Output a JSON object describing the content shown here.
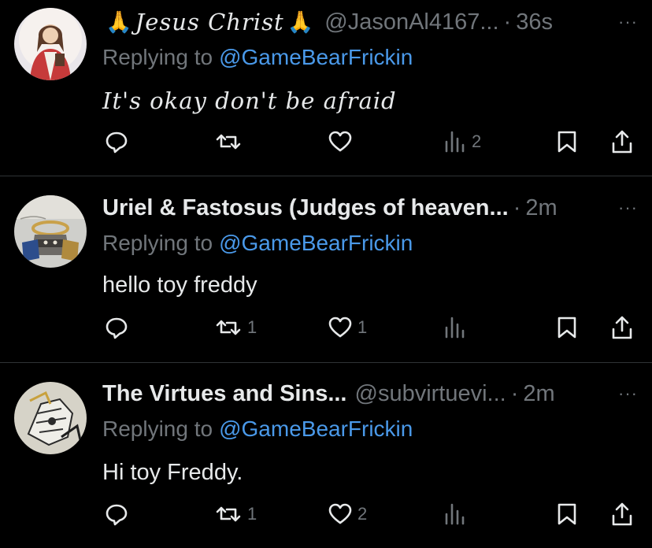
{
  "tweets": [
    {
      "display_name": "Jesus Christ",
      "name_emoji": "🙏",
      "handle": "@JasonAl4167...",
      "separator": "·",
      "time": "36s",
      "more": "···",
      "reply_prefix": "Replying to",
      "reply_to": "@GameBearFrickin",
      "text": "It's okay don't be afraid",
      "replies": "",
      "retweets": "",
      "likes": "",
      "views": "2"
    },
    {
      "display_name": "Uriel & Fastosus (Judges of heaven...",
      "handle": "",
      "separator": "·",
      "time": "2m",
      "more": "···",
      "reply_prefix": "Replying to",
      "reply_to": "@GameBearFrickin",
      "text": "hello toy freddy",
      "replies": "",
      "retweets": "1",
      "likes": "1",
      "views": ""
    },
    {
      "display_name": "The Virtues and Sins...",
      "handle": "@subvirtuevi...",
      "separator": "·",
      "time": "2m",
      "more": "···",
      "reply_prefix": "Replying to",
      "reply_to": "@GameBearFrickin",
      "text": "Hi toy Freddy.",
      "replies": "",
      "retweets": "1",
      "likes": "2",
      "views": ""
    }
  ],
  "icons": {
    "reply": "reply-icon",
    "retweet": "retweet-icon",
    "like": "heart-icon",
    "views": "views-icon",
    "bookmark": "bookmark-icon",
    "share": "share-icon",
    "more": "more-icon"
  },
  "colors": {
    "background": "#000000",
    "text": "#e7e9ea",
    "muted": "#71767b",
    "mention": "#4a99e9",
    "divider": "#2f3336"
  }
}
